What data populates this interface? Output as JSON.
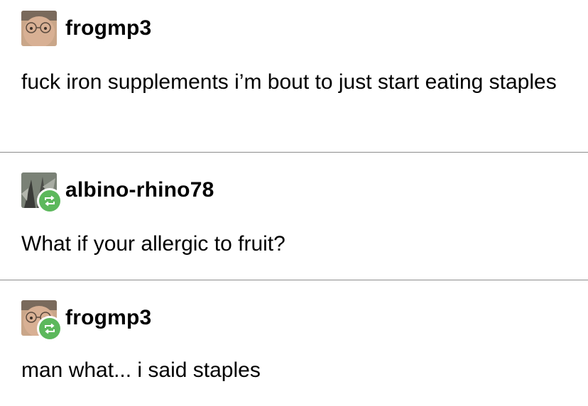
{
  "posts": [
    {
      "username": "frogmp3",
      "reblogged": false,
      "text": "fuck iron supplements i’m bout to just start eating staples"
    },
    {
      "username": "albino-rhino78",
      "reblogged": true,
      "text": "What if your allergic to fruit?"
    },
    {
      "username": "frogmp3",
      "reblogged": true,
      "text": "man what... i said staples"
    }
  ],
  "colors": {
    "reblog_badge": "#5cb85c",
    "divider": "#8c8c8c",
    "text": "#000000"
  }
}
